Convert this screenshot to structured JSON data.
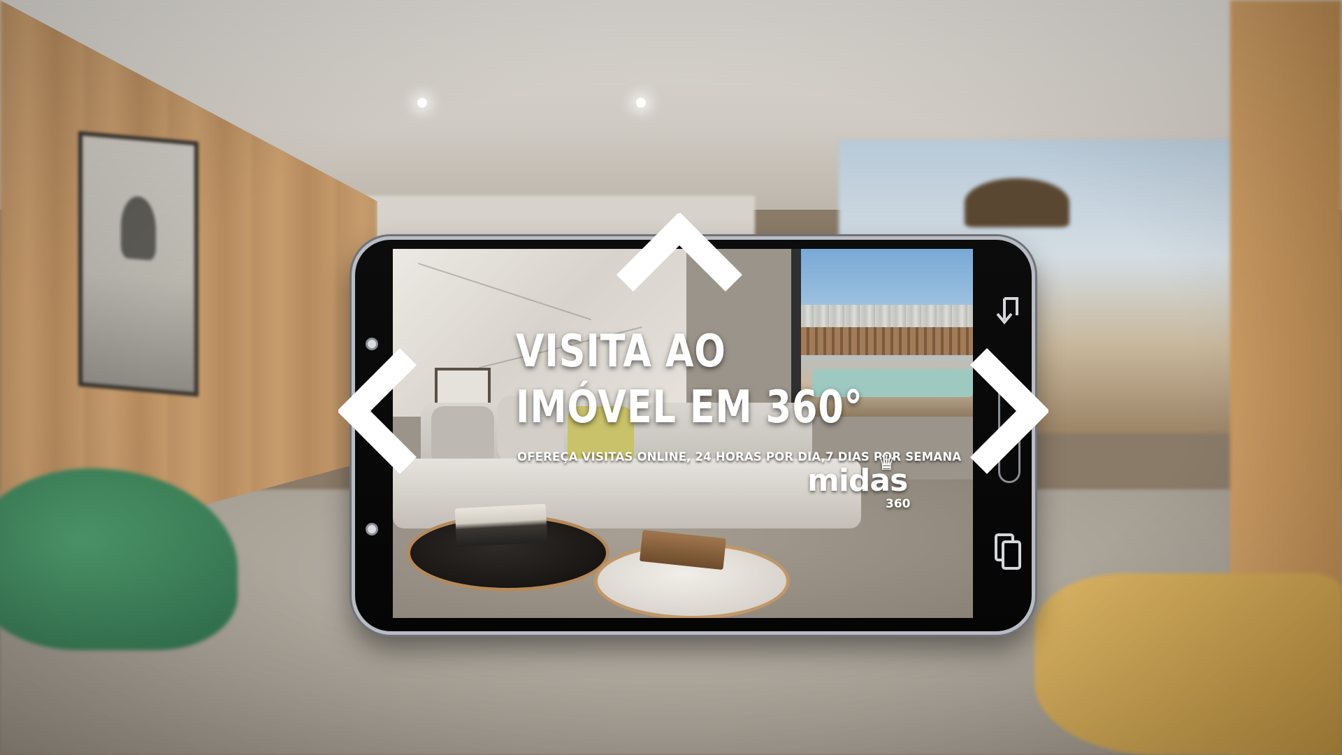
{
  "hero": {
    "headline_line1": "VISITA AO",
    "headline_line2": "IMÓVEL EM 360°",
    "subline": "OFEREÇA VISITAS ONLINE, 24 HORAS POR DIA,7 DIAS POR SEMANA"
  },
  "brand": {
    "name": "midas",
    "suffix": "360"
  },
  "navigation": {
    "up_icon": "chevron-up-icon",
    "left_icon": "chevron-left-icon",
    "right_icon": "chevron-right-icon"
  },
  "phone_buttons": {
    "back_icon": "back-arrow-icon",
    "recent_icon": "recent-apps-icon"
  },
  "colors": {
    "arrow": "#ffffff",
    "text": "#ffffff",
    "phone_body": "#050505",
    "phone_frame": "#b9bcc2"
  }
}
